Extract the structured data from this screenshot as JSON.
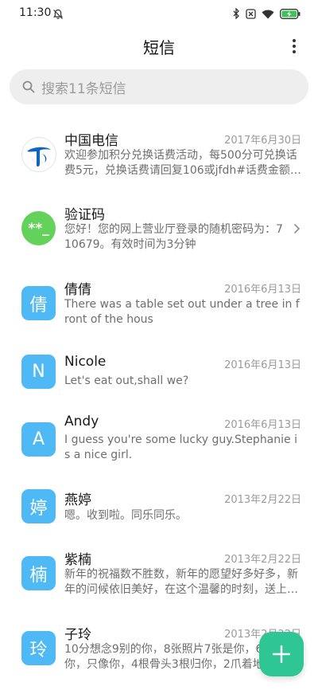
{
  "status_bar": {
    "time": "11:30",
    "icons": [
      "bell-off-icon",
      "bluetooth-icon",
      "sim-off-icon",
      "wifi-icon",
      "battery-charging-icon"
    ]
  },
  "header": {
    "title": "短信",
    "more_icon": "more-vertical-icon"
  },
  "search": {
    "placeholder": "搜索11条短信",
    "icon": "search-icon"
  },
  "conversations": [
    {
      "name": "中国电信",
      "date": "2017年6月30日",
      "preview": "欢迎参加积分兑换话费活动，每500分可兑换话费5元，兑换话费请回复106或jfdh#话费金额…",
      "avatar_type": "telecom-logo"
    },
    {
      "name": "验证码",
      "date": "",
      "preview": "您好！您的网上营业厅登录的随机密码为：710679。有效时间为3分钟",
      "avatar_text": "**_",
      "avatar_type": "verification-code"
    },
    {
      "name": "倩倩",
      "date": "2016年6月13日",
      "preview": "There was a table set out under a tree in front of the hous",
      "avatar_text": "倩"
    },
    {
      "name": "Nicole",
      "date": "2016年6月13日",
      "preview": "Let's eat out,shall we?",
      "avatar_text": "N"
    },
    {
      "name": "Andy",
      "date": "2016年6月13日",
      "preview": "I guess you're some lucky guy.Stephanie is a nice girl.",
      "avatar_text": "A"
    },
    {
      "name": "燕婷",
      "date": "2013年2月22日",
      "preview": "嗯。收到啦。同乐同乐。",
      "avatar_text": "婷"
    },
    {
      "name": "紫楠",
      "date": "2013年2月22日",
      "preview": "新年的祝福数不胜数，新年的愿望好多好多，新年的问候依旧美好，在这个温馨的时刻，送上…",
      "avatar_text": "楠"
    },
    {
      "name": "子玲",
      "date": "2013年2月22日",
      "preview": "10分想念9别的你，8张照片7张是你，6只想你，只像你，4根骨头3根归你，2爪着地1定是",
      "avatar_text": "玲"
    }
  ],
  "fab": {
    "icon": "plus-icon"
  },
  "colors": {
    "avatar_blue": "#4fb9f6",
    "avatar_green": "#64d25a",
    "fab_green": "#2ec695",
    "telecom_blue": "#0a66c2"
  }
}
